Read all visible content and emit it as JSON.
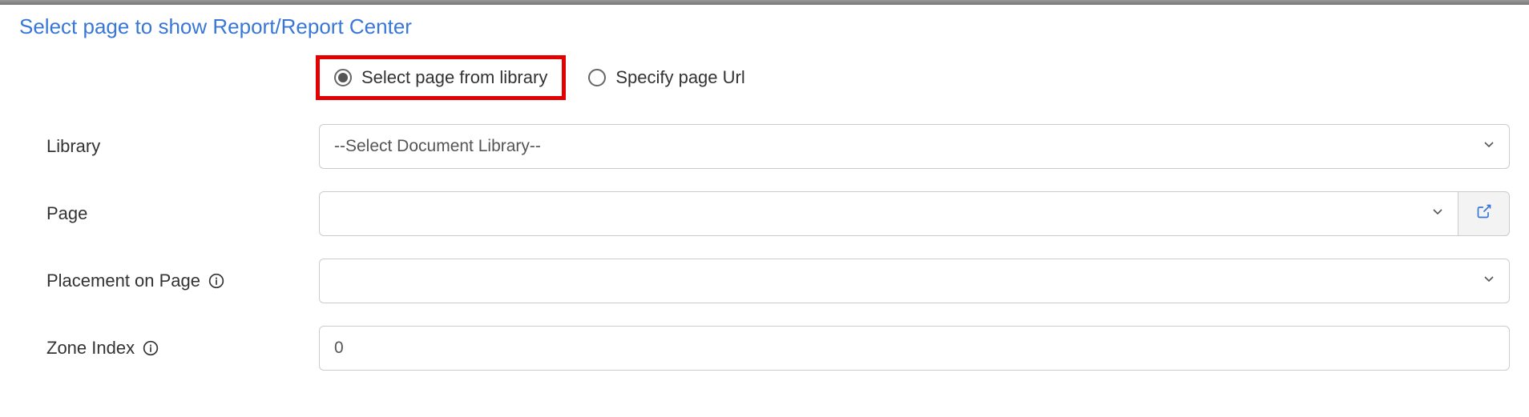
{
  "section": {
    "title": "Select page to show Report/Report Center"
  },
  "radios": {
    "optionLibrary": "Select page from library",
    "optionUrl": "Specify page Url"
  },
  "labels": {
    "library": "Library",
    "page": "Page",
    "placement": "Placement on Page",
    "zoneIndex": "Zone Index"
  },
  "fields": {
    "libraryPlaceholder": "--Select Document Library--",
    "pageValue": "",
    "placementValue": "",
    "zoneIndexValue": "0"
  }
}
